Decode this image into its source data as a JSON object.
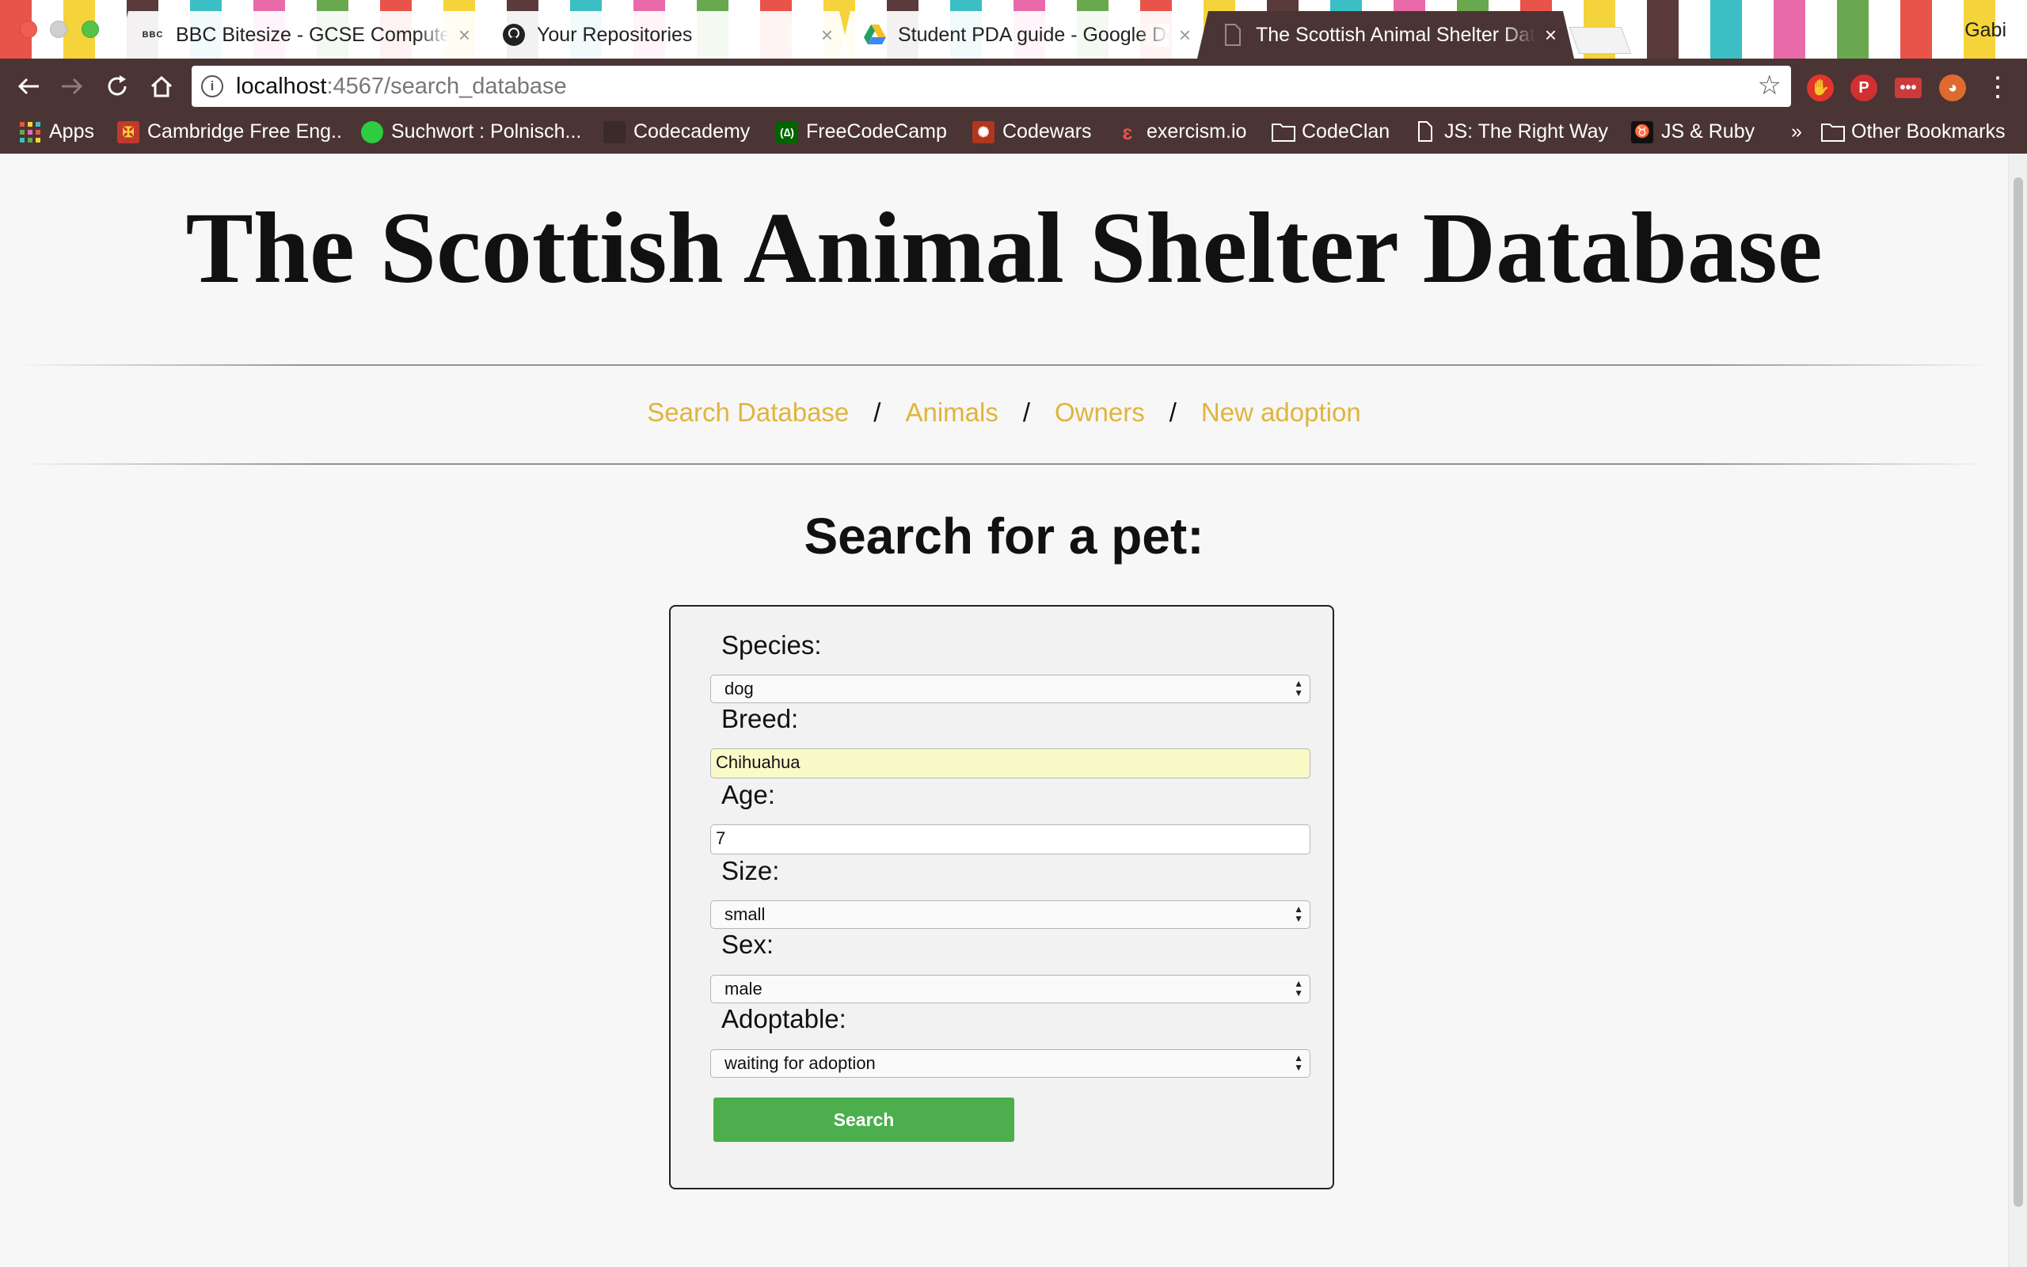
{
  "browser": {
    "tabs": [
      {
        "title": "BBC Bitesize - GCSE Computer Science",
        "favicon": "bbc-icon",
        "active": false
      },
      {
        "title": "Your Repositories",
        "favicon": "github-icon",
        "active": false
      },
      {
        "title": "Student PDA guide - Google Docs",
        "favicon": "google-drive-icon",
        "active": false
      },
      {
        "title": "The Scottish Animal Shelter Database",
        "favicon": "document-icon",
        "active": true
      }
    ],
    "profile_name": "Gabi",
    "url_host": "localhost",
    "url_rest": ":4567/search_database",
    "bookmarks": [
      {
        "label": "Apps",
        "icon": "apps-grid-icon"
      },
      {
        "label": "Cambridge Free Eng..",
        "icon": "cambridge-icon"
      },
      {
        "label": "Suchwort : Polnisch...",
        "icon": "speech-bubble-icon"
      },
      {
        "label": "Codecademy",
        "icon": "codecademy-icon"
      },
      {
        "label": "FreeCodeCamp",
        "icon": "freecodecamp-icon"
      },
      {
        "label": "Codewars",
        "icon": "codewars-icon"
      },
      {
        "label": "exercism.io",
        "icon": "exercism-icon"
      },
      {
        "label": "CodeClan",
        "icon": "folder-icon"
      },
      {
        "label": "JS: The Right Way",
        "icon": "document-icon"
      },
      {
        "label": "JS & Ruby",
        "icon": "ox-icon"
      }
    ],
    "bookmarks_overflow": "»",
    "other_bookmarks": "Other Bookmarks"
  },
  "page": {
    "title": "The Scottish Animal Shelter Database",
    "nav": {
      "items": [
        "Search Database",
        "Animals",
        "Owners",
        "New adoption"
      ],
      "separator": "/"
    },
    "heading": "Search for a pet:",
    "form": {
      "species": {
        "label": "Species:",
        "value": "dog"
      },
      "breed": {
        "label": "Breed:",
        "value": "Chihuahua"
      },
      "age": {
        "label": "Age:",
        "value": "7"
      },
      "size": {
        "label": "Size:",
        "value": "small"
      },
      "sex": {
        "label": "Sex:",
        "value": "male"
      },
      "adoptable": {
        "label": "Adoptable:",
        "value": "waiting for adoption"
      },
      "submit_label": "Search"
    }
  },
  "colors": {
    "chrome": "#4b3434",
    "nav_link": "#e0b43c",
    "search_button": "#4cae4c",
    "autofill": "#fafac8"
  }
}
